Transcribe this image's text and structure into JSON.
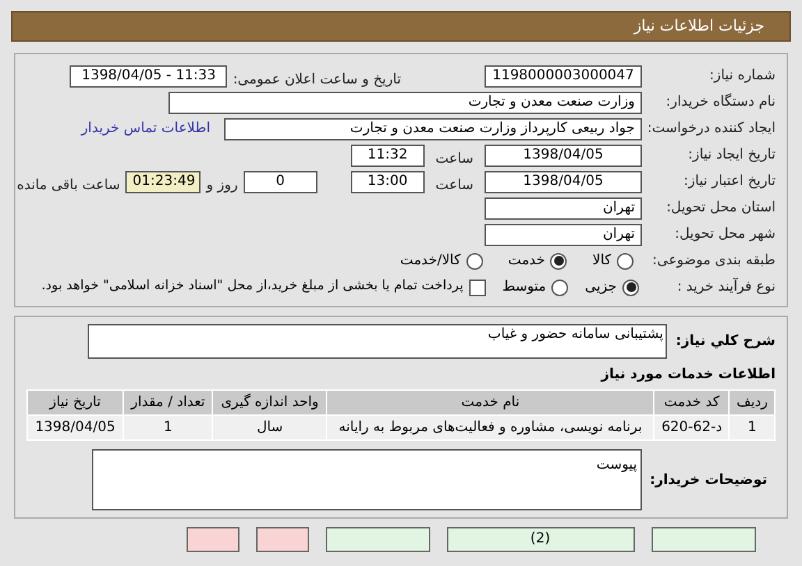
{
  "header": {
    "title": "جزئیات اطلاعات نیاز"
  },
  "details": {
    "need_number": {
      "label": "شماره نیاز:",
      "value": "1198000003000047"
    },
    "announce": {
      "label": "تاریخ و ساعت اعلان عمومی:",
      "value": "1398/04/05 - 11:33"
    },
    "buyer": {
      "label": "نام دستگاه خریدار:",
      "value": "وزارت صنعت معدن و تجارت"
    },
    "requester": {
      "label": "ایجاد کننده درخواست:",
      "value": "جواد ربیعی کارپرداز وزارت صنعت معدن و تجارت",
      "link": "اطلاعات تماس خریدار"
    },
    "created": {
      "label": "تاریخ ایجاد نیاز:",
      "date": "1398/04/05",
      "time_label": "ساعت",
      "time": "11:32"
    },
    "valid": {
      "label": "تاریخ اعتبار نیاز:",
      "date": "1398/04/05",
      "time_label": "ساعت",
      "time": "13:00",
      "days": "0",
      "days_label": "روز و",
      "remaining": "01:23:49",
      "remaining_label": "ساعت باقی مانده"
    },
    "province": {
      "label": "استان محل تحویل:",
      "value": "تهران"
    },
    "city": {
      "label": "شهر محل تحویل:",
      "value": "تهران"
    },
    "category": {
      "label": "طبقه بندی موضوعی:",
      "options": [
        {
          "label": "کالا",
          "selected": false
        },
        {
          "label": "خدمت",
          "selected": true
        },
        {
          "label": "کالا/خدمت",
          "selected": false
        }
      ]
    },
    "process": {
      "label": "نوع فرآیند خرید :",
      "options": [
        {
          "label": "جزیی",
          "selected": true
        },
        {
          "label": "متوسط",
          "selected": false
        }
      ],
      "payment": {
        "label": "پرداخت تمام یا بخشی از مبلغ خرید،از محل \"اسناد خزانه اسلامی\" خواهد بود.",
        "checked": false
      }
    }
  },
  "need": {
    "description_label": "شرح کلي نیاز:",
    "description": "پشتیبانی سامانه حضور و غیاب",
    "services_title": "اطلاعات خدمات مورد نیاز",
    "table": {
      "columns": [
        "ردیف",
        "کد خدمت",
        "نام خدمت",
        "واحد اندازه گیری",
        "تعداد / مقدار",
        "تاریخ نیاز"
      ],
      "rows": [
        [
          "1",
          "د-62-620",
          "برنامه نویسی، مشاوره و فعالیت‌های مربوط به رایانه",
          "سال",
          "1",
          "1398/04/05"
        ]
      ]
    },
    "buyer_notes_label": "توضیحات خریدار:",
    "buyer_notes": "پیوست"
  },
  "buttons": [
    {
      "color": "#e2f4e2"
    },
    {
      "color": "#e2f4e2",
      "label": "(2)"
    },
    {
      "color": "#e2f4e2"
    },
    {
      "color": "#f8d4d4"
    },
    {
      "color": "#f8d4d4"
    }
  ]
}
